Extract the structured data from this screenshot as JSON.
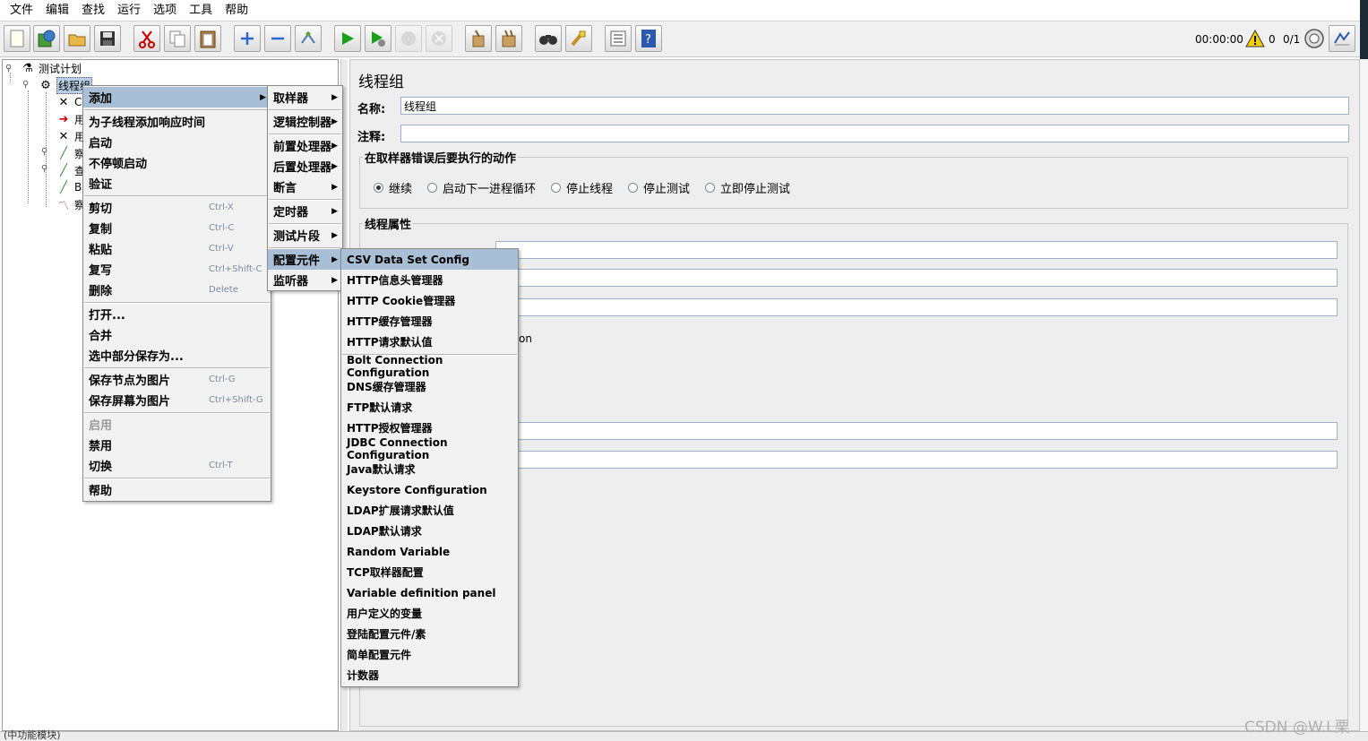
{
  "menubar": [
    "文件",
    "编辑",
    "查找",
    "运行",
    "选项",
    "工具",
    "帮助"
  ],
  "toolbar": {
    "timer": "00:00:00",
    "error_count": "0",
    "thread_count": "0/1",
    "icons": [
      "new-icon",
      "templates-icon",
      "open-icon",
      "save-icon",
      "cut-icon",
      "copy-icon",
      "paste-icon",
      "expand-icon",
      "collapse-icon",
      "toggle-icon",
      "start-icon",
      "start-no-pause-icon",
      "stop-icon",
      "shutdown-icon",
      "clear-icon",
      "clear-all-icon",
      "search-icon",
      "reset-search-icon",
      "function-helper-icon",
      "help-icon",
      "warning-icon",
      "remote-icon",
      "language-icon"
    ]
  },
  "tree": {
    "root": "测试计划",
    "thread_group": "线程组",
    "children_partial": [
      "C",
      "用",
      "用",
      "察",
      "查",
      "B",
      "察"
    ]
  },
  "panel": {
    "title": "线程组",
    "name_label": "名称:",
    "name_value": "线程组",
    "comment_label": "注释:",
    "comment_value": "",
    "error_action_legend": "在取样器错误后要执行的动作",
    "error_actions": [
      {
        "label": "继续",
        "selected": true
      },
      {
        "label": "启动下一进程循环",
        "selected": false
      },
      {
        "label": "停止线程",
        "selected": false
      },
      {
        "label": "停止测试",
        "selected": false
      },
      {
        "label": "立即停止测试",
        "selected": false
      }
    ],
    "thread_props_legend": "线程属性",
    "partial_text": "on"
  },
  "context_menu": {
    "items": [
      {
        "label": "添加",
        "shortcut": "",
        "submenu": true,
        "active": true
      },
      {
        "label": "为子线程添加响应时间",
        "shortcut": ""
      },
      {
        "label": "启动",
        "shortcut": ""
      },
      {
        "label": "不停顿启动",
        "shortcut": ""
      },
      {
        "label": "验证",
        "shortcut": ""
      },
      {
        "label": "剪切",
        "shortcut": "Ctrl-X"
      },
      {
        "label": "复制",
        "shortcut": "Ctrl-C"
      },
      {
        "label": "粘贴",
        "shortcut": "Ctrl-V"
      },
      {
        "label": "复写",
        "shortcut": "Ctrl+Shift-C"
      },
      {
        "label": "删除",
        "shortcut": "Delete"
      },
      {
        "label": "打开...",
        "shortcut": ""
      },
      {
        "label": "合并",
        "shortcut": ""
      },
      {
        "label": "选中部分保存为...",
        "shortcut": ""
      },
      {
        "label": "保存节点为图片",
        "shortcut": "Ctrl-G"
      },
      {
        "label": "保存屏幕为图片",
        "shortcut": "Ctrl+Shift-G"
      },
      {
        "label": "启用",
        "shortcut": "",
        "disabled": true
      },
      {
        "label": "禁用",
        "shortcut": ""
      },
      {
        "label": "切换",
        "shortcut": "Ctrl-T"
      },
      {
        "label": "帮助",
        "shortcut": ""
      }
    ]
  },
  "add_submenu": {
    "items": [
      "取样器",
      "逻辑控制器",
      "前置处理器",
      "后置处理器",
      "断言",
      "定时器",
      "测试片段",
      "配置元件",
      "监听器"
    ]
  },
  "config_submenu": {
    "items": [
      "CSV Data Set Config",
      "HTTP信息头管理器",
      "HTTP Cookie管理器",
      "HTTP缓存管理器",
      "HTTP请求默认值",
      "Bolt Connection Configuration",
      "DNS缓存管理器",
      "FTP默认请求",
      "HTTP授权管理器",
      "JDBC Connection Configuration",
      "Java默认请求",
      "Keystore Configuration",
      "LDAP扩展请求默认值",
      "LDAP默认请求",
      "Random Variable",
      "TCP取样器配置",
      "Variable definition panel",
      "用户定义的变量",
      "登陆配置元件/素",
      "简单配置元件",
      "计数器"
    ]
  },
  "watermark": "CSDN @W.L栗",
  "bottom_text": "(中功能模块)"
}
